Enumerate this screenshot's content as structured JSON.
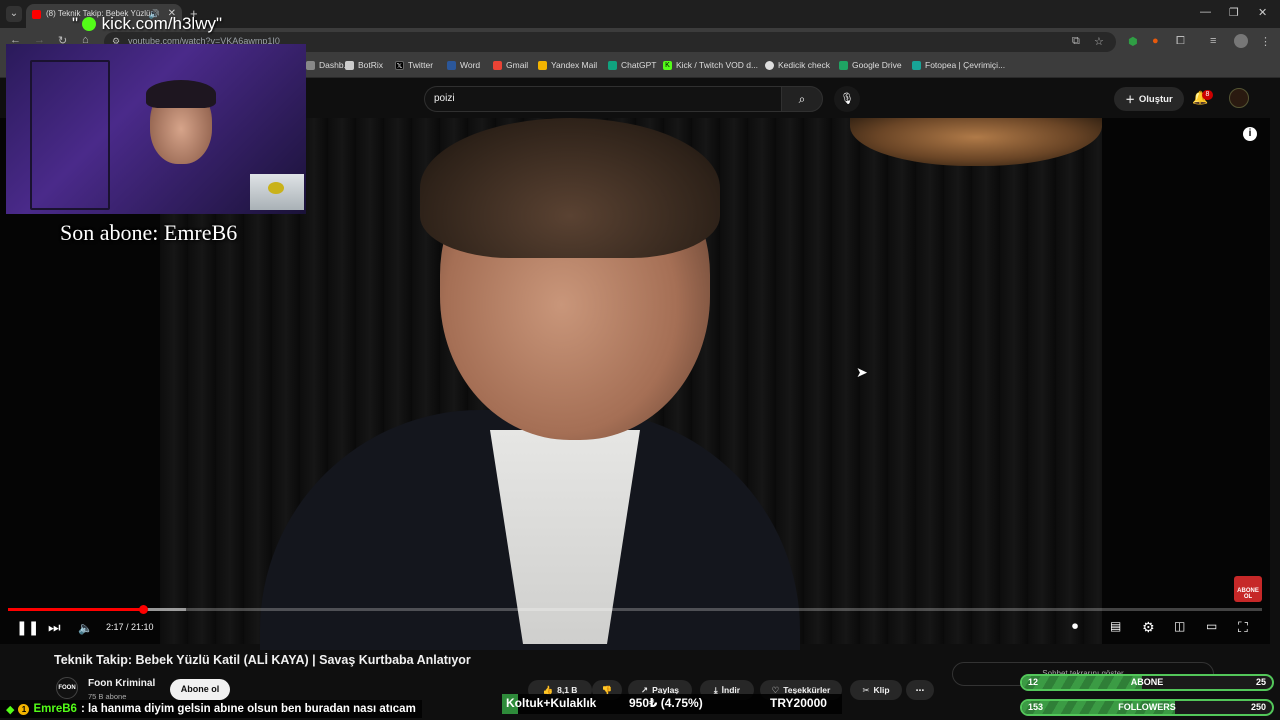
{
  "browser": {
    "tab_title": "(8) Teknik Takip: Bebek Yüzlü",
    "url": "youtube.com/watch?v=VKA6awmp1I0",
    "bookmarks": [
      {
        "label": "Dashb...",
        "icon": "dashboard-icon",
        "color": "#888888"
      },
      {
        "label": "BotRix",
        "icon": "botrix-icon",
        "color": "#cccccc"
      },
      {
        "label": "Twitter",
        "icon": "x-icon",
        "color": "#000000"
      },
      {
        "label": "Word",
        "icon": "word-icon",
        "color": "#2b579a"
      },
      {
        "label": "Gmail",
        "icon": "gmail-icon",
        "color": "#ea4335"
      },
      {
        "label": "Yandex Mail",
        "icon": "mail-icon",
        "color": "#f2b300"
      },
      {
        "label": "ChatGPT",
        "icon": "chatgpt-icon",
        "color": "#10a37f"
      },
      {
        "label": "Kick / Twitch VOD d...",
        "icon": "kick-icon",
        "color": "#53fc18"
      },
      {
        "label": "Kedicik check",
        "icon": "globe-icon",
        "color": "#dddddd"
      },
      {
        "label": "Google Drive",
        "icon": "drive-icon",
        "color": "#1fa463"
      },
      {
        "label": "Fotopea | Çevrimiçi...",
        "icon": "photopea-icon",
        "color": "#18a497"
      }
    ]
  },
  "youtube": {
    "search_value": "poizi",
    "create_label": "Oluştur",
    "notification_count": "8"
  },
  "player": {
    "time": "2:17 / 21:10",
    "progress": 0.108,
    "buffered": 0.142,
    "corner_badge": "ABONE OL"
  },
  "overlay": {
    "kick_prefix": "\"",
    "kick_url": "kick.com/h3lwy\"",
    "last_sub": "Son abone: EmreB6",
    "chat_badge": "1",
    "chat_user": "EmreB6",
    "chat_text": ": la hanıma diyim gelsin abıne olsun ben buradan nası atıcam",
    "donate_label": "Koltuk+Kulaklık",
    "donate_price": "950₺ (4.75%)",
    "donate_goal": "TRY20000",
    "goals": [
      {
        "left": "12",
        "label": "ABONE",
        "right": "25",
        "fraction": 0.48
      },
      {
        "left": "153",
        "label": "FOLLOWERS",
        "right": "250",
        "fraction": 0.612
      }
    ]
  },
  "video": {
    "title": "Teknik Takip: Bebek Yüzlü Katil (ALİ KAYA) | Savaş Kurtbaba Anlatıyor",
    "channel_logo": "FOON",
    "channel_name": "Foon Kriminal",
    "channel_subs": "75 B abone",
    "subscribe_label": "Abone ol",
    "likes": "8,1 B",
    "share": "Paylaş",
    "download": "İndir",
    "thanks": "Teşekkürler",
    "clip": "Klip",
    "chat_replay": "Sohbet tekrarını göster"
  }
}
